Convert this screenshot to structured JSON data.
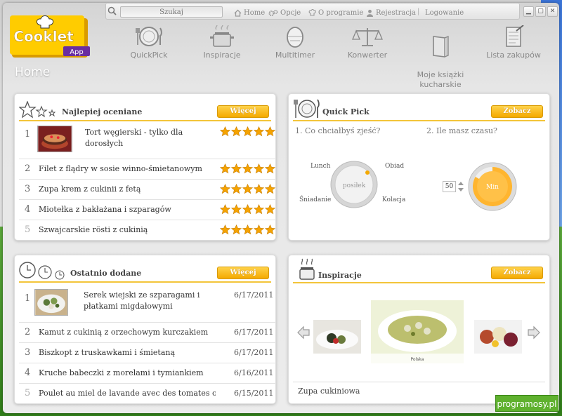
{
  "search": {
    "placeholder": "Szukaj"
  },
  "toplinks": [
    {
      "label": "Home",
      "icon": "house-icon"
    },
    {
      "label": "Opcje",
      "icon": "gears-icon"
    },
    {
      "label": "O programie",
      "icon": "chef-hat-icon"
    },
    {
      "label": "Rejestracja",
      "icon": "person-icon"
    },
    {
      "label": "Logowanie"
    }
  ],
  "logo": {
    "text": "Cooklet",
    "sub": "App"
  },
  "nav": [
    {
      "label": "QuickPick",
      "icon": "plate-fork-knife-icon"
    },
    {
      "label": "Inspiracje",
      "icon": "steaming-pot-icon"
    },
    {
      "label": "Multitimer",
      "icon": "egg-timer-icon"
    },
    {
      "label": "Konwerter",
      "icon": "scales-icon"
    },
    {
      "label": "Moje książki\nkucharskie",
      "icon": "cookbook-icon"
    },
    {
      "label": "Lista zakupów",
      "icon": "checklist-icon"
    }
  ],
  "page_title": "Home",
  "top_rated": {
    "title": "Najlepiej oceniane",
    "button": "Więcej",
    "items": [
      {
        "num": "1",
        "name": "Tort węgierski - tylko dla\ndorosłych",
        "stars": 5
      },
      {
        "num": "2",
        "name": "Filet z flądry w sosie winno-śmietanowym",
        "stars": 5
      },
      {
        "num": "3",
        "name": "Zupa krem z cukinii z fetą",
        "stars": 5
      },
      {
        "num": "4",
        "name": "Miotełka z bakłażana i szparagów",
        "stars": 5
      },
      {
        "num": "5",
        "name": "Szwajcarskie rösti  z cukinią",
        "stars": 5
      }
    ]
  },
  "quick_pick": {
    "title": "Quick Pick",
    "button": "Zobacz",
    "q1": "1. Co chciałbyś zjeść?",
    "q2": "2. Ile masz czasu?",
    "meals": {
      "lunch": "Lunch",
      "obiad": "Obiad",
      "sniadanie": "Śniadanie",
      "kolacja": "Kolacja"
    },
    "dial_label": "posiłek",
    "time_value": "50",
    "time_unit": "Min"
  },
  "recent": {
    "title": "Ostatnio dodane",
    "button": "Więcej",
    "items": [
      {
        "num": "1",
        "name": "Serek wiejski ze szparagami i\npłatkami migdałowymi",
        "date": "6/17/2011"
      },
      {
        "num": "2",
        "name": "Kamut z cukinią z orzechowym kurczakiem",
        "date": "6/17/2011"
      },
      {
        "num": "3",
        "name": "Biszkopt z truskawkami i śmietaną",
        "date": "6/17/2011"
      },
      {
        "num": "4",
        "name": "Kruche babeczki z morelami i tymiankiem",
        "date": "6/16/2011"
      },
      {
        "num": "5",
        "name": "Poulet au miel de lavande avec des tomates o",
        "date": "6/15/2011"
      }
    ]
  },
  "inspiration": {
    "title": "Inspiracje",
    "button": "Zobacz",
    "caption": "Polska",
    "dish": "Zupa cukiniowa"
  },
  "watermark": "programosy.pl",
  "colors": {
    "accent": "#f4a900",
    "star": "#f5a300",
    "underline": "#f3c53a",
    "logo_bg": "#ffcc00",
    "logo_badge": "#6a2ea0"
  }
}
